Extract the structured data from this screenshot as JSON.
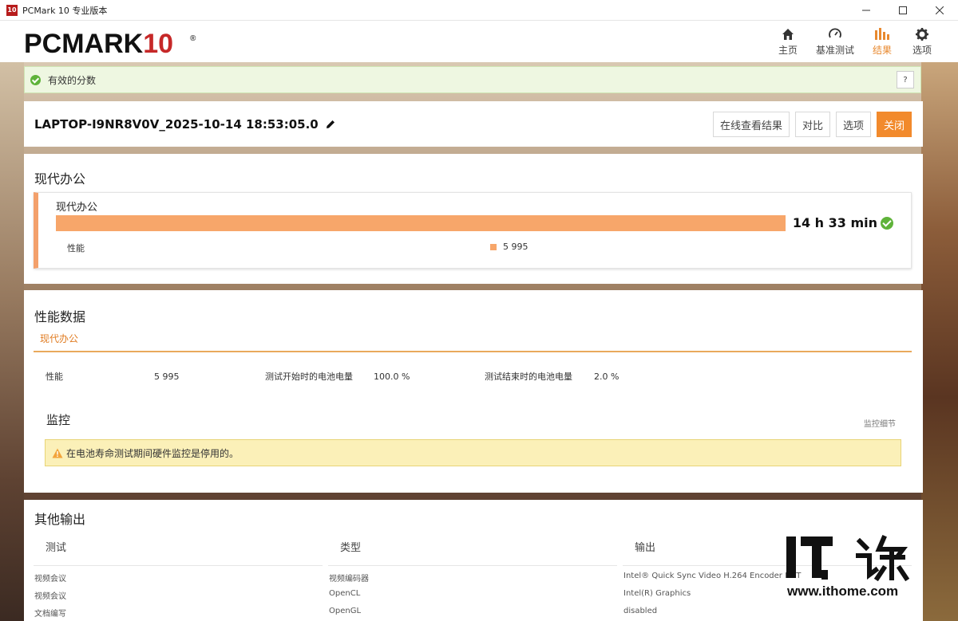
{
  "window": {
    "title": "PCMark 10 专业版本",
    "icon_text": "10"
  },
  "header": {
    "logo_text": "PCMARK",
    "logo_number": "10",
    "logo_mark": "®",
    "nav": [
      {
        "label": "主页",
        "icon": "home-icon"
      },
      {
        "label": "基准测试",
        "icon": "gauge-icon"
      },
      {
        "label": "结果",
        "icon": "bar-chart-icon",
        "active": true
      },
      {
        "label": "选项",
        "icon": "gear-icon"
      }
    ]
  },
  "valid": {
    "text": "有效的分数",
    "help": "?"
  },
  "result": {
    "name": "LAPTOP-I9NR8V0V_2025-10-14 18:53:05.0",
    "buttons": {
      "online": "在线查看结果",
      "compare": "对比",
      "options": "选项",
      "close": "关闭"
    }
  },
  "modern_office": {
    "section_title": "现代办公",
    "card_title": "现代办公",
    "score": "14 h 33 min",
    "perf_label": "性能",
    "perf_value": "5 995"
  },
  "perf_data": {
    "section_title": "性能数据",
    "tab": "现代办公",
    "rows": [
      {
        "label": "性能",
        "value": "5 995"
      },
      {
        "label": "测试开始时的电池电量",
        "value": "100.0 %"
      },
      {
        "label": "测试结束时的电池电量",
        "value": "2.0 %"
      }
    ],
    "monitor_title": "监控",
    "monitor_link": "监控细节",
    "warning": "在电池寿命测试期间硬件监控是停用的。"
  },
  "other_output": {
    "section_title": "其他输出",
    "headers": [
      "测试",
      "类型",
      "输出"
    ],
    "rows": [
      [
        "视频会议",
        "视频编码器",
        "Intel® Quick Sync Video H.264 Encoder MFT"
      ],
      [
        "视频会议",
        "OpenCL",
        "Intel(R) Graphics"
      ],
      [
        "文档编写",
        "OpenGL",
        "disabled"
      ]
    ]
  },
  "watermark": {
    "url": "www.ithome.com"
  },
  "colors": {
    "accent": "#f28a2c",
    "bar": "#f7a66a",
    "valid_bg": "#eef7e1",
    "warn_bg": "#fbf0b8"
  }
}
